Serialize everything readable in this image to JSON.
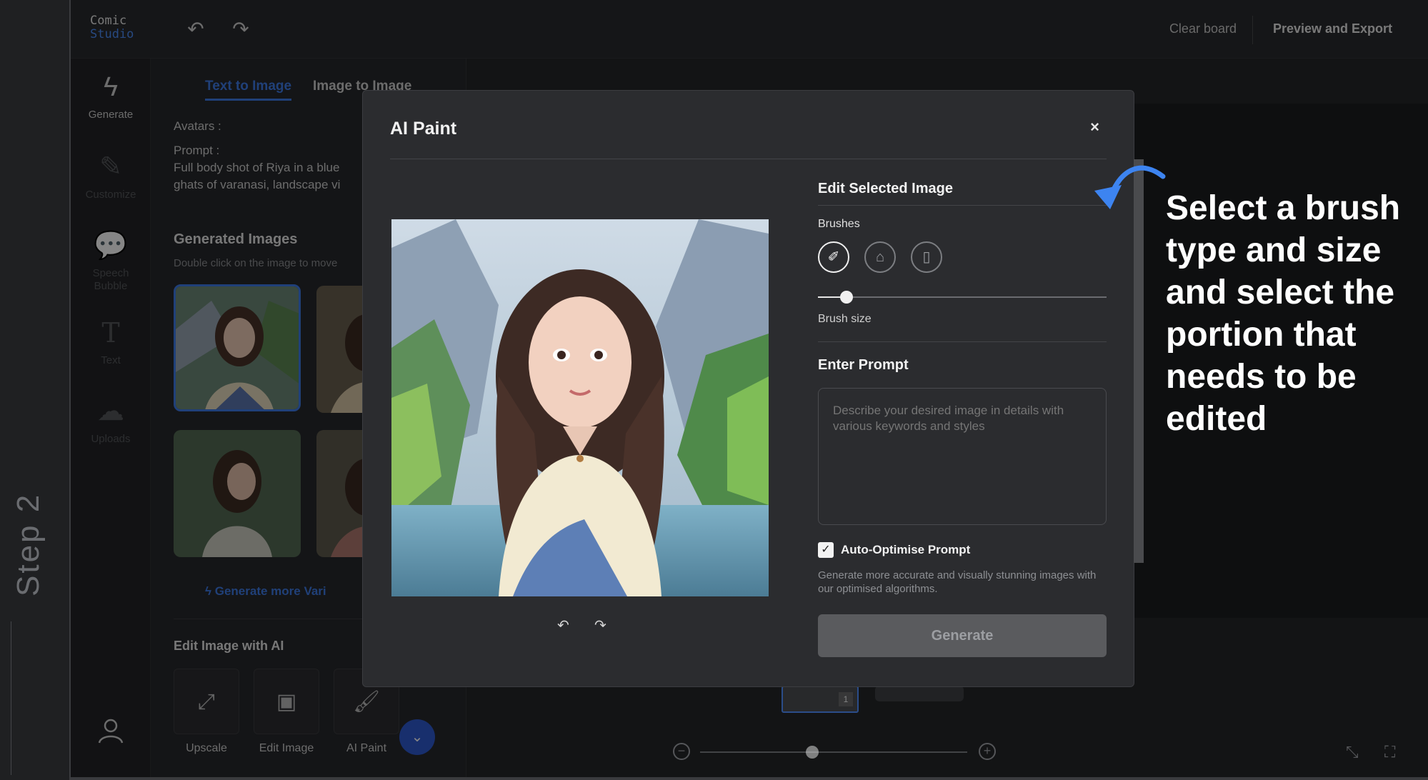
{
  "gutter": {
    "step_label": "Step 2"
  },
  "topbar": {
    "logo_line1": "Comic",
    "logo_line2": "Studio",
    "clear_board": "Clear board",
    "preview_export": "Preview and Export"
  },
  "rail": {
    "items": [
      {
        "label": "Generate"
      },
      {
        "label": "Customize"
      },
      {
        "label": "Speech Bubble"
      },
      {
        "label": "Text"
      },
      {
        "label": "Uploads"
      }
    ]
  },
  "panel": {
    "tabs": [
      {
        "label": "Text to Image"
      },
      {
        "label": "Image to Image"
      }
    ],
    "avatars_label": "Avatars :",
    "prompt_label": "Prompt :",
    "prompt_line1": "Full body shot of Riya in a blue",
    "prompt_line2": "ghats of varanasi, landscape vi",
    "generated_title": "Generated Images",
    "generated_hint": "Double click on the image to move",
    "generate_more": "Generate more Vari",
    "edit_ai_title": "Edit Image with AI",
    "tools": [
      {
        "label": "Upscale"
      },
      {
        "label": "Edit Image"
      },
      {
        "label": "AI Paint"
      }
    ]
  },
  "canvas": {
    "page_number": "1"
  },
  "modal": {
    "title": "AI Paint",
    "close": "×",
    "edit_selected_title": "Edit Selected Image",
    "brushes_label": "Brushes",
    "brush_size_label": "Brush size",
    "brush_size_value": 0.1,
    "enter_prompt_title": "Enter Prompt",
    "prompt_placeholder": "Describe your desired image in details with various keywords and styles",
    "auto_optimise_label": "Auto-Optimise Prompt",
    "auto_optimise_checked": true,
    "auto_optimise_desc": "Generate more accurate and visually stunning images with our optimised algorithms.",
    "generate_button": "Generate"
  },
  "annotation": {
    "text": "Select a brush type and size and select the portion that needs to be edited"
  },
  "colors": {
    "accent": "#3f7ce8",
    "annotation_arrow": "#3d84f0"
  }
}
